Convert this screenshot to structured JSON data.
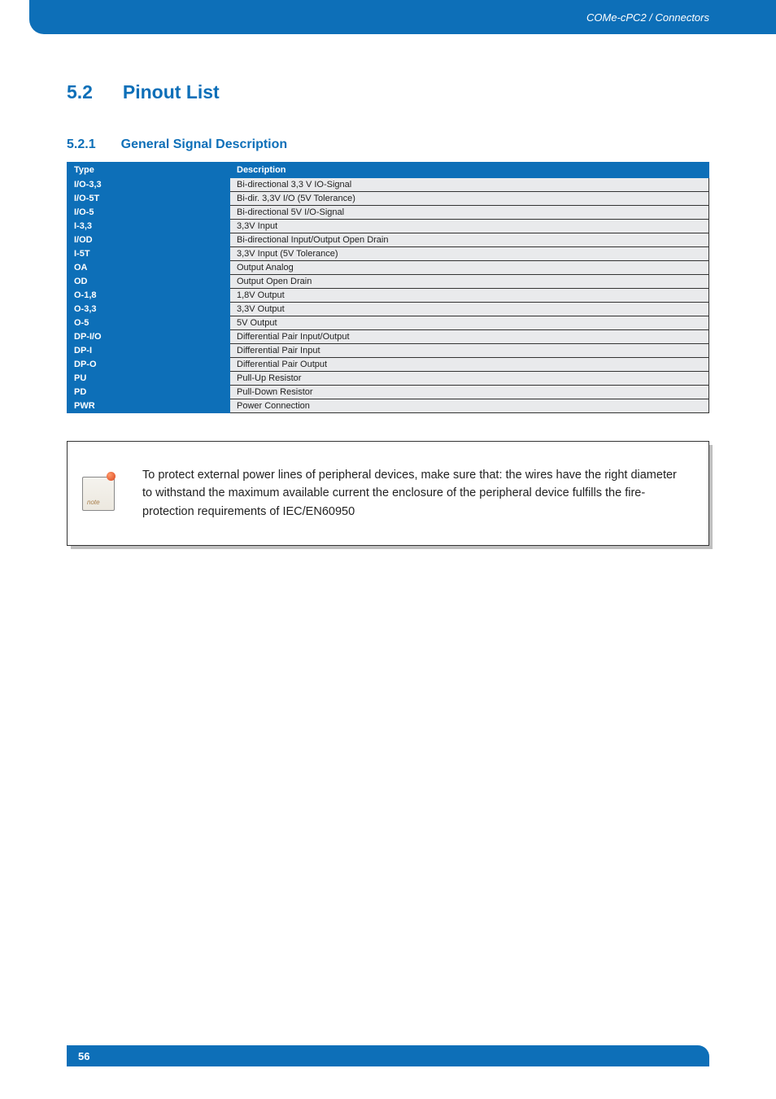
{
  "header": {
    "breadcrumb": "COMe-cPC2 / Connectors"
  },
  "section": {
    "number": "5.2",
    "title": "Pinout List"
  },
  "subsection": {
    "number": "5.2.1",
    "title": "General Signal Description"
  },
  "table": {
    "col_type": "Type",
    "col_desc": "Description",
    "rows": [
      {
        "type": "I/O-3,3",
        "desc": "Bi-directional 3,3 V IO-Signal"
      },
      {
        "type": "I/O-5T",
        "desc": "Bi-dir. 3,3V I/O (5V Tolerance)"
      },
      {
        "type": "I/O-5",
        "desc": "Bi-directional 5V I/O-Signal"
      },
      {
        "type": "I-3,3",
        "desc": "3,3V Input"
      },
      {
        "type": "I/OD",
        "desc": "Bi-directional Input/Output Open Drain"
      },
      {
        "type": "I-5T",
        "desc": "3,3V Input (5V Tolerance)"
      },
      {
        "type": "OA",
        "desc": "Output Analog"
      },
      {
        "type": "OD",
        "desc": "Output Open Drain"
      },
      {
        "type": "O-1,8",
        "desc": "1,8V Output"
      },
      {
        "type": "O-3,3",
        "desc": "3,3V Output"
      },
      {
        "type": "O-5",
        "desc": "5V Output"
      },
      {
        "type": "DP-I/O",
        "desc": "Differential Pair Input/Output"
      },
      {
        "type": "DP-I",
        "desc": "Differential Pair Input"
      },
      {
        "type": "DP-O",
        "desc": "Differential Pair Output"
      },
      {
        "type": "PU",
        "desc": "Pull-Up Resistor"
      },
      {
        "type": "PD",
        "desc": "Pull-Down Resistor"
      },
      {
        "type": "PWR",
        "desc": "Power Connection"
      }
    ]
  },
  "note": {
    "icon_label": "note",
    "text": "To protect external power lines of peripheral devices, make sure that: the wires have the right diameter to withstand the maximum available current the enclosure of the peripheral device fulfills the fire-protection requirements of IEC/EN60950"
  },
  "footer": {
    "page": "56"
  }
}
